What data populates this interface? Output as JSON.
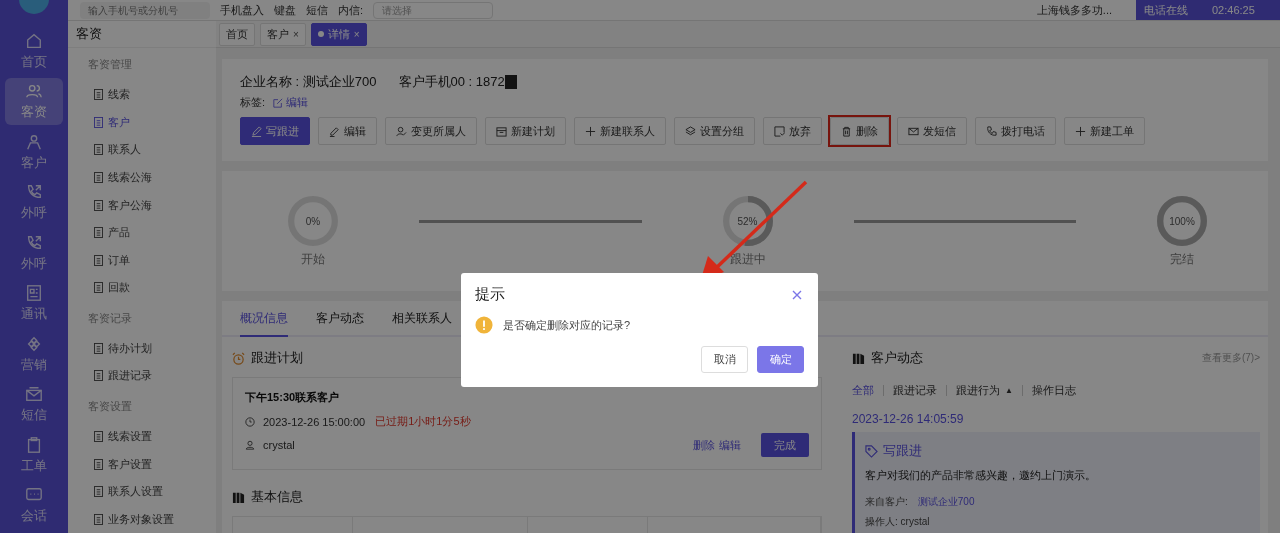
{
  "topbar": {
    "search": {
      "placeholder": "输入手机号或分机号"
    },
    "items": [
      "手机盘入",
      "键盘",
      "短信"
    ],
    "select_label": "内信:",
    "select": {
      "placeholder": "请选择"
    },
    "company": "上海钱多多功...",
    "call_status": "电话在线",
    "call_timer": "02:46:25"
  },
  "nav": [
    {
      "label": "首页",
      "selected": false
    },
    {
      "label": "客资",
      "selected": true
    },
    {
      "label": "客户",
      "selected": false
    },
    {
      "label": "外呼",
      "selected": false
    },
    {
      "label": "外呼",
      "selected": false
    },
    {
      "label": "通讯",
      "selected": false
    },
    {
      "label": "营销",
      "selected": false
    },
    {
      "label": "短信",
      "selected": false
    },
    {
      "label": "工单",
      "selected": false
    },
    {
      "label": "会话",
      "selected": false
    }
  ],
  "sidebar": {
    "title": "客资",
    "groups": [
      {
        "title": "客资管理",
        "items": [
          {
            "label": "线索",
            "selected": false
          },
          {
            "label": "客户",
            "selected": true
          },
          {
            "label": "联系人",
            "selected": false
          },
          {
            "label": "线索公海",
            "selected": false
          },
          {
            "label": "客户公海",
            "selected": false
          },
          {
            "label": "产品",
            "selected": false
          },
          {
            "label": "订单",
            "selected": false
          },
          {
            "label": "回款",
            "selected": false
          }
        ]
      },
      {
        "title": "客资记录",
        "items": [
          {
            "label": "待办计划",
            "selected": false
          },
          {
            "label": "跟进记录",
            "selected": false
          }
        ]
      },
      {
        "title": "客资设置",
        "items": [
          {
            "label": "线索设置",
            "selected": false
          },
          {
            "label": "客户设置",
            "selected": false
          },
          {
            "label": "联系人设置",
            "selected": false
          },
          {
            "label": "业务对象设置",
            "selected": false
          }
        ]
      }
    ]
  },
  "page_tabs": [
    {
      "label": "首页",
      "selected": false
    },
    {
      "label": "客户",
      "close": "×",
      "selected": false
    },
    {
      "label": "详情",
      "close": "×",
      "selected": true
    }
  ],
  "header": {
    "company": "企业名称 : 测试企业700",
    "phone": "客户手机00 : 1872",
    "tags_label": "标签:",
    "tags_edit": "编辑"
  },
  "actions": [
    {
      "label": "写跟进",
      "primary": true,
      "highlighted": false
    },
    {
      "label": "编辑",
      "primary": false,
      "highlighted": false
    },
    {
      "label": "变更所属人",
      "primary": false,
      "highlighted": false
    },
    {
      "label": "新建计划",
      "primary": false,
      "highlighted": false
    },
    {
      "label": "新建联系人",
      "primary": false,
      "highlighted": false
    },
    {
      "label": "设置分组",
      "primary": false,
      "highlighted": false
    },
    {
      "label": "放弃",
      "primary": false,
      "highlighted": false
    },
    {
      "label": "删除",
      "primary": false,
      "highlighted": true
    },
    {
      "label": "发短信",
      "primary": false,
      "highlighted": false
    },
    {
      "label": "拨打电话",
      "primary": false,
      "highlighted": false
    },
    {
      "label": "新建工单",
      "primary": false,
      "highlighted": false
    }
  ],
  "stages": [
    {
      "percent": "0%",
      "label": "开始",
      "level": 0
    },
    {
      "percent": "52%",
      "label": "跟进中",
      "level": 0.52
    },
    {
      "percent": "100%",
      "label": "完结",
      "level": 1
    }
  ],
  "detail_tabs": [
    {
      "label": "概况信息",
      "selected": true
    },
    {
      "label": "客户动态",
      "selected": false
    },
    {
      "label": "相关联系人",
      "selected": false
    }
  ],
  "plan": {
    "title": "跟进计划",
    "item_title": "下午15:30联系客户",
    "time": "2023-12-26 15:00:00",
    "overdue": "已过期1小时1分5秒",
    "owner": "crystal",
    "links": [
      "删除",
      "编辑"
    ],
    "done": "完成"
  },
  "basic": {
    "title": "基本信息"
  },
  "activity": {
    "title": "客户动态",
    "more": "查看更多(7)>",
    "filters": [
      {
        "label": "全部",
        "selected": true
      },
      {
        "label": "跟进记录",
        "selected": false
      },
      {
        "label": "跟进行为",
        "selected": false,
        "caret": "▲"
      },
      {
        "label": "操作日志",
        "selected": false
      }
    ],
    "date": "2023-12-26 14:05:59",
    "entry": {
      "type": "写跟进",
      "text": "客户对我们的产品非常感兴趣，邀约上门演示。",
      "from_label": "来自客户:",
      "from": "测试企业700",
      "operator": "操作人: crystal"
    }
  },
  "dialog": {
    "title": "提示",
    "message": "是否确定删除对应的记录?",
    "cancel": "取消",
    "confirm": "确定"
  }
}
